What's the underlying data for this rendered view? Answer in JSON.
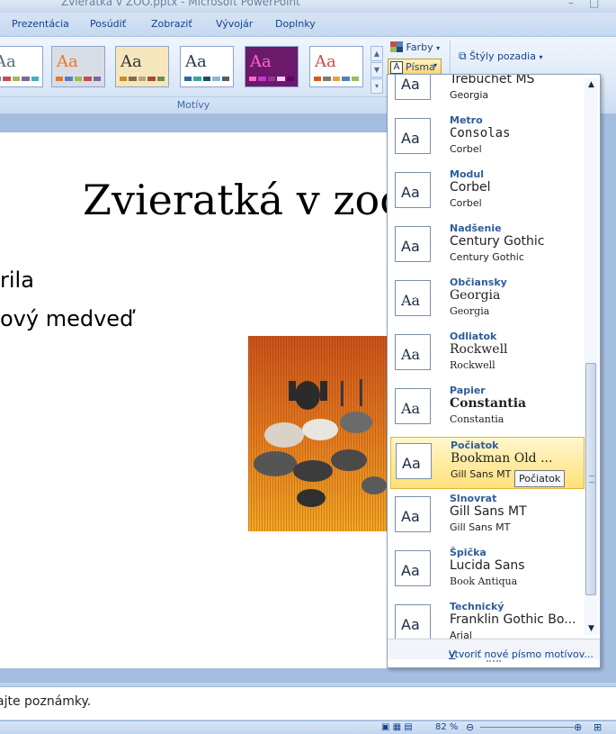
{
  "window": {
    "title": "Zvieratká v ZOO.pptx - Microsoft PowerPoint",
    "minimize": "–",
    "maximize": "□"
  },
  "tabs": [
    "Prezentácia",
    "Posúdiť",
    "Zobraziť",
    "Vývojár",
    "Doplnky"
  ],
  "ribbon": {
    "themes_group_label": "Motívy",
    "theme_thumb_label": "Aa",
    "colors_button": "Farby",
    "fonts_button": "Písma",
    "bg_styles_button": "Štýly pozadia",
    "theme_colors": [
      {
        "text": "#5a6b7a",
        "bg": "#ffffff",
        "swatches": [
          "#4f81bd",
          "#c0504d",
          "#9bbb59",
          "#8064a2",
          "#4bacc6"
        ]
      },
      {
        "text": "#e8762b",
        "bg": "#d9dde6",
        "swatches": [
          "#e8762b",
          "#4f81bd",
          "#9bbb59",
          "#c0504d",
          "#8064a2"
        ]
      },
      {
        "text": "#333333",
        "bg": "#f6e6bc",
        "swatches": [
          "#c98b2a",
          "#7f6d4b",
          "#b9a27c",
          "#a44b3a",
          "#6e8a5a"
        ]
      },
      {
        "text": "#2c3a4a",
        "bg": "#ffffff",
        "swatches": [
          "#2c6aa0",
          "#37a3a3",
          "#1c4e6c",
          "#8ab7d6",
          "#5a5a5a"
        ]
      },
      {
        "text": "#ff66cc",
        "bg": "#6b1a6b",
        "swatches": [
          "#ff66cc",
          "#cc33cc",
          "#993399",
          "#ffccff",
          "#660066"
        ]
      },
      {
        "text": "#c0504d",
        "bg": "#ffffff",
        "swatches": [
          "#d85a1a",
          "#7a7a7a",
          "#e8a04a",
          "#4f81bd",
          "#9bbb59"
        ]
      }
    ]
  },
  "slide": {
    "title": "Zvieratká v zoo",
    "bullets": [
      "rila",
      "ový medveď"
    ]
  },
  "notes_placeholder": "ajte poznámky.",
  "status": {
    "zoom": "82 %"
  },
  "font_gallery": {
    "icon_label": "Aa",
    "items": [
      {
        "name": "",
        "heading": "Trebuchet MS",
        "body": "Georgia"
      },
      {
        "name": "Metro",
        "heading": "Consolas",
        "body": "Corbel"
      },
      {
        "name": "Modul",
        "heading": "Corbel",
        "body": "Corbel"
      },
      {
        "name": "Nadšenie",
        "heading": "Century Gothic",
        "body": "Century Gothic"
      },
      {
        "name": "Občiansky",
        "heading": "Georgia",
        "body": "Georgia"
      },
      {
        "name": "Odliatok",
        "heading": "Rockwell",
        "body": "Rockwell"
      },
      {
        "name": "Papier",
        "heading": "Constantia",
        "body": "Constantia"
      },
      {
        "name": "Počiatok",
        "heading": "Bookman Old ...",
        "body": "Gill Sans MT"
      },
      {
        "name": "Slnovrat",
        "heading": "Gill Sans MT",
        "body": "Gill Sans MT"
      },
      {
        "name": "Špička",
        "heading": "Lucida Sans",
        "body": "Book Antiqua"
      },
      {
        "name": "Technický",
        "heading": "Franklin Gothic Bo...",
        "body": "Arial"
      }
    ],
    "create_link_first": "V",
    "create_link_rest": "ytvoriť nové písmo motívov...",
    "tooltip": "Počiatok"
  }
}
